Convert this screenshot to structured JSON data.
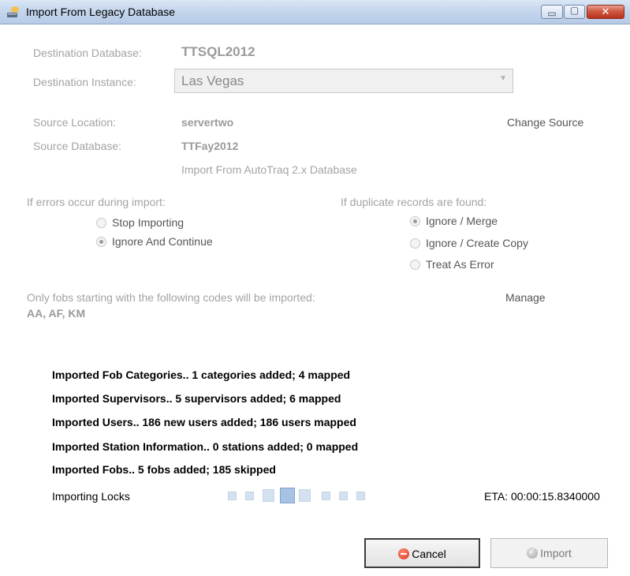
{
  "window": {
    "title": "Import From Legacy Database",
    "minimize_glyph": "▭",
    "maximize_glyph": "▢",
    "close_glyph": "✕"
  },
  "destination": {
    "database_label": "Destination Database:",
    "database_value": "TTSQL2012",
    "instance_label": "Destination Instance:",
    "instance_value": "Las Vegas"
  },
  "source": {
    "location_label": "Source Location:",
    "location_value": "servertwo",
    "change_link": "Change Source",
    "database_label": "Source Database:",
    "database_value": "TTFay2012",
    "import_note": "Import From AutoTraq 2.x Database"
  },
  "errors_group": {
    "label": "If errors occur during import:",
    "options": [
      {
        "label": "Stop Importing",
        "checked": false
      },
      {
        "label": "Ignore And Continue",
        "checked": true
      }
    ]
  },
  "duplicates_group": {
    "label": "If duplicate records are found:",
    "options": [
      {
        "label": "Ignore / Merge",
        "checked": true
      },
      {
        "label": "Ignore / Create Copy",
        "checked": false
      },
      {
        "label": "Treat As Error",
        "checked": false
      }
    ]
  },
  "fobs": {
    "label": "Only fobs starting with the following codes will be imported:",
    "manage_link": "Manage",
    "codes": "AA, AF, KM"
  },
  "status_lines": [
    "Imported Fob Categories..  1 categories added; 4 mapped",
    "Imported Supervisors..  5 supervisors added; 6 mapped",
    "Imported Users..  186 new users added; 186 users mapped",
    "Imported Station Information..  0 stations added; 0 mapped",
    "Imported Fobs..  5 fobs added; 185 skipped"
  ],
  "progress": {
    "label": "Importing Locks",
    "eta": "ETA: 00:00:15.8340000"
  },
  "buttons": {
    "cancel": "Cancel",
    "import": "Import"
  },
  "colors": {
    "title_bar": "#c3d5ec",
    "close_button": "#c9482f",
    "progress_active": "#a8c2e4"
  }
}
